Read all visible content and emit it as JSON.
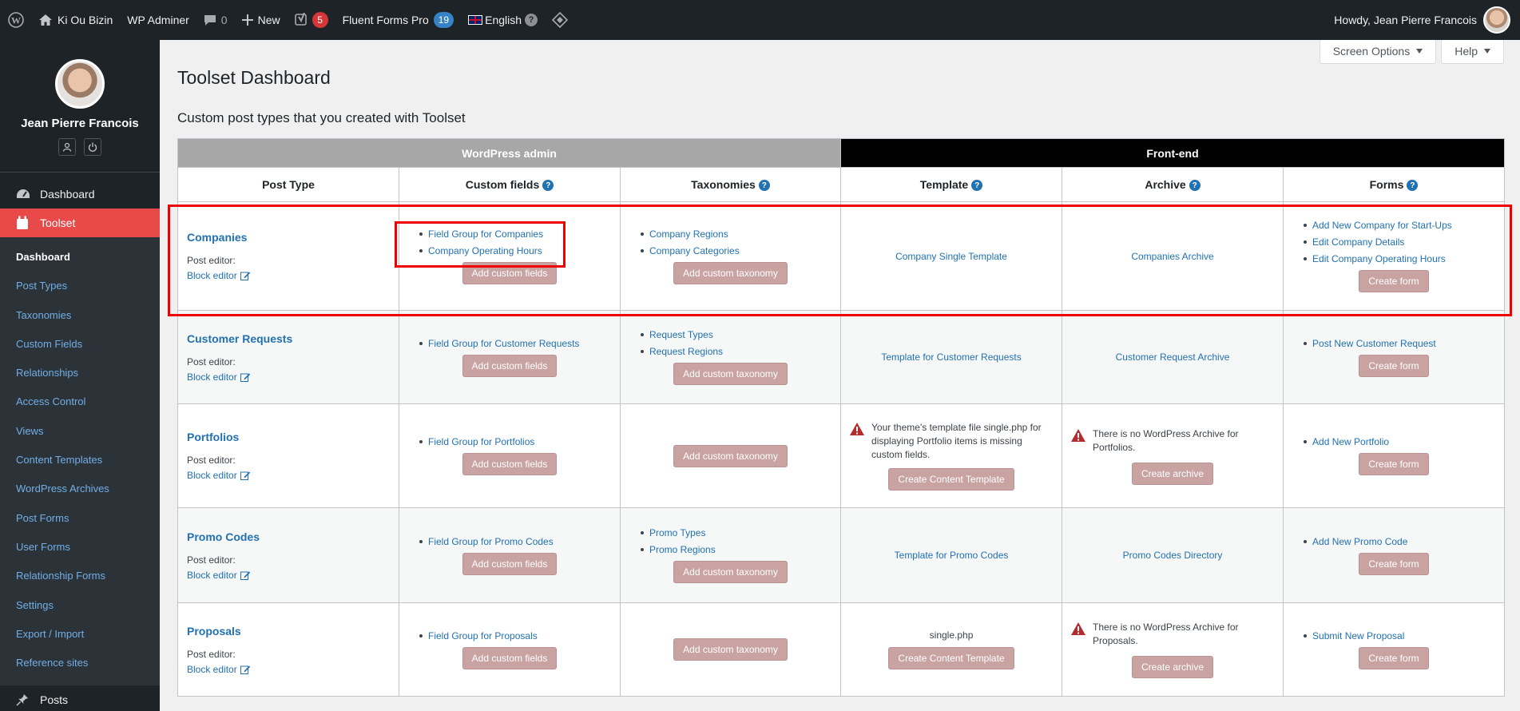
{
  "adminbar": {
    "site_name": "Ki Ou Bizin",
    "wp_adminer": "WP Adminer",
    "comments_count": "0",
    "new_label": "New",
    "yoast_count": "5",
    "fluent_label": "Fluent Forms Pro",
    "fluent_count": "19",
    "language": "English",
    "greeting": "Howdy, Jean Pierre Francois"
  },
  "sidebar": {
    "profile_name": "Jean Pierre Francois",
    "dashboard": "Dashboard",
    "toolset": "Toolset",
    "posts": "Posts",
    "sub_items": [
      "Dashboard",
      "Post Types",
      "Taxonomies",
      "Custom Fields",
      "Relationships",
      "Access Control",
      "Views",
      "Content Templates",
      "WordPress Archives",
      "Post Forms",
      "User Forms",
      "Relationship Forms",
      "Settings",
      "Export / Import",
      "Reference sites"
    ]
  },
  "header": {
    "screen_options": "Screen Options",
    "help": "Help",
    "title": "Toolset Dashboard",
    "section": "Custom post types that you created with Toolset"
  },
  "table": {
    "band_wp": "WordPress admin",
    "band_fe": "Front-end",
    "columns": [
      "Post Type",
      "Custom fields",
      "Taxonomies",
      "Template",
      "Archive",
      "Forms"
    ],
    "help_glyph": "?",
    "post_editor": "Post editor:",
    "block_editor": "Block editor",
    "add_fields": "Add custom fields",
    "add_taxonomy": "Add custom taxonomy",
    "create_form": "Create form",
    "create_template": "Create Content Template",
    "create_archive": "Create archive",
    "rows": [
      {
        "name": "Companies",
        "fields": [
          "Field Group for Companies",
          "Company Operating Hours"
        ],
        "taxonomies": [
          "Company Regions",
          "Company Categories"
        ],
        "template": "Company Single Template",
        "archive": "Companies Archive",
        "forms": [
          "Add New Company for Start-Ups",
          "Edit Company Details",
          "Edit Company Operating Hours"
        ]
      },
      {
        "name": "Customer Requests",
        "fields": [
          "Field Group for Customer Requests"
        ],
        "taxonomies": [
          "Request Types",
          "Request Regions"
        ],
        "template": "Template for Customer Requests",
        "archive": "Customer Request Archive",
        "forms": [
          "Post New Customer Request"
        ]
      },
      {
        "name": "Portfolios",
        "fields": [
          "Field Group for Portfolios"
        ],
        "template_warning": "Your theme's template file single.php for displaying Portfolio items is missing custom fields.",
        "archive_warning": "There is no WordPress Archive for Portfolios.",
        "forms": [
          "Add New Portfolio"
        ]
      },
      {
        "name": "Promo Codes",
        "fields": [
          "Field Group for Promo Codes"
        ],
        "taxonomies": [
          "Promo Types",
          "Promo Regions"
        ],
        "template": "Template for Promo Codes",
        "archive": "Promo Codes Directory",
        "forms": [
          "Add New Promo Code"
        ]
      },
      {
        "name": "Proposals",
        "fields": [
          "Field Group for Proposals"
        ],
        "template_file": "single.php",
        "archive_warning": "There is no WordPress Archive for Proposals.",
        "forms": [
          "Submit New Proposal"
        ]
      }
    ]
  },
  "colors": {
    "highlight": "#e00000",
    "toolset_active": "#e84a4a",
    "button": "#c9a3a2"
  }
}
